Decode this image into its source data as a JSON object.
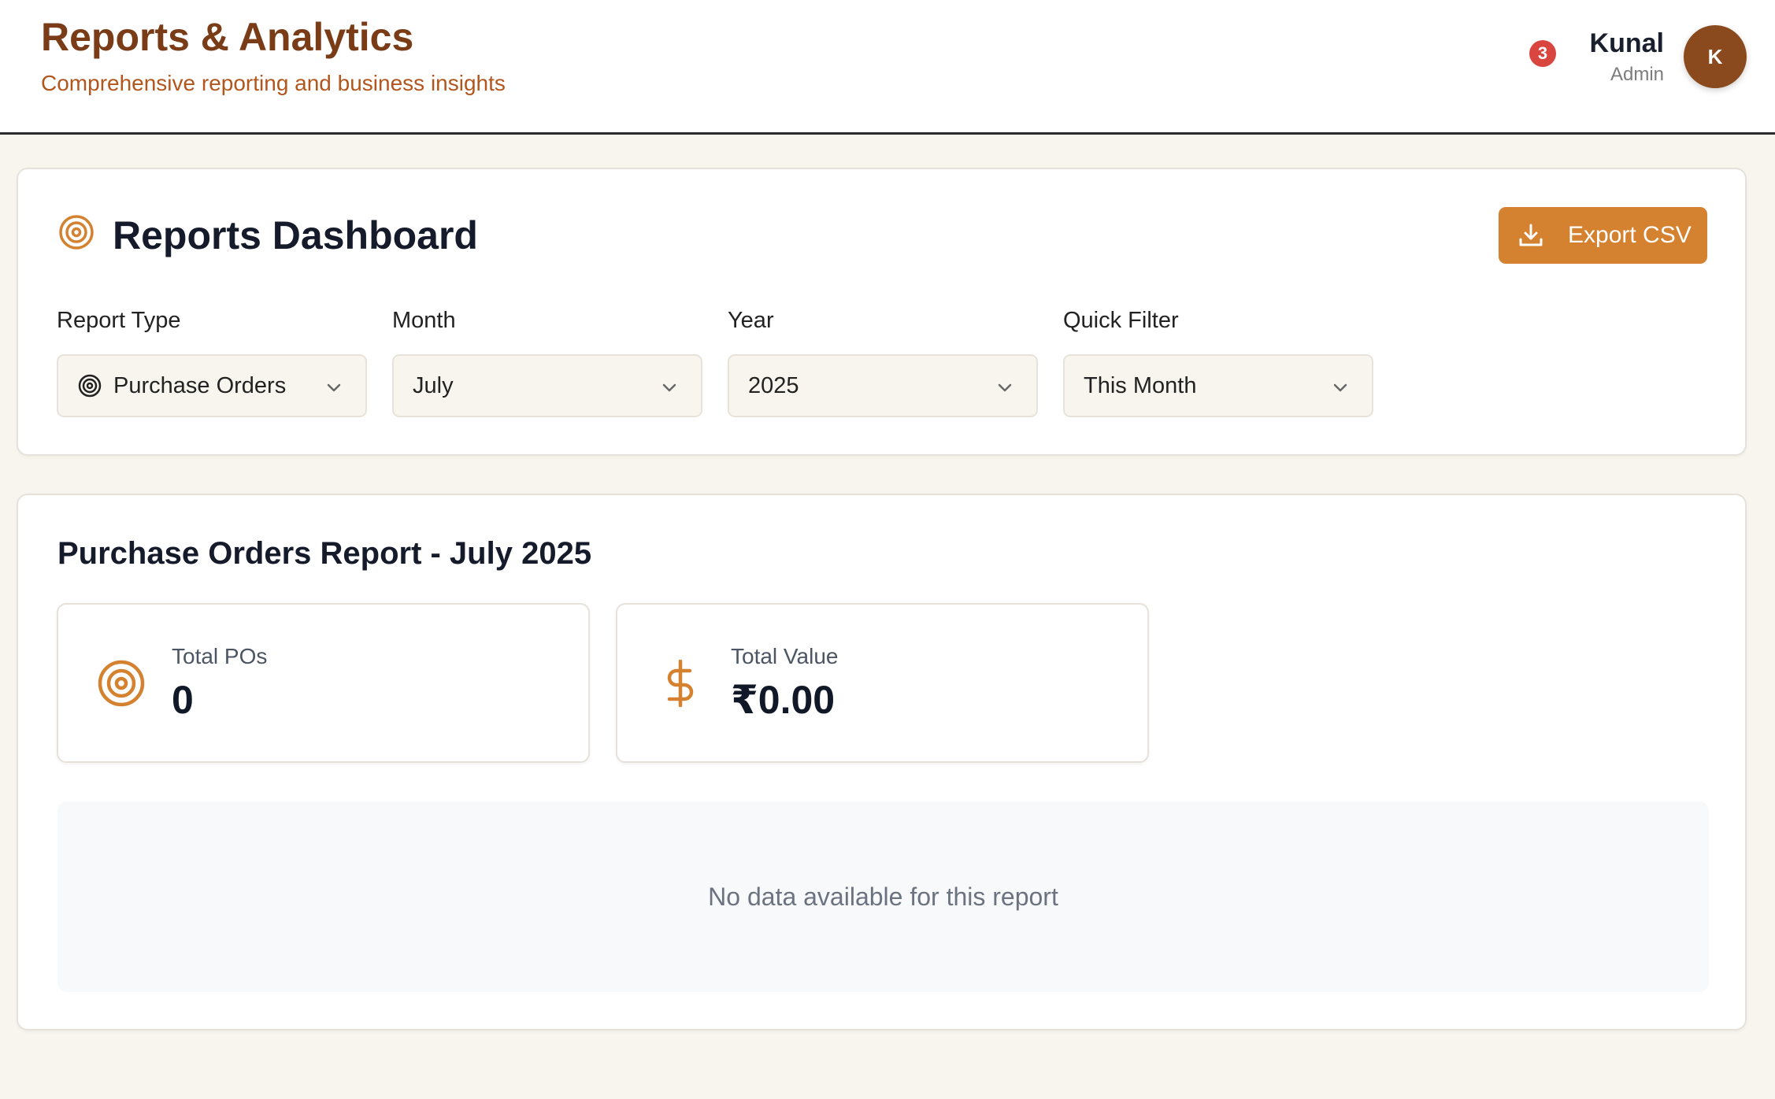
{
  "header": {
    "title": "Reports & Analytics",
    "subtitle": "Comprehensive reporting and business insights",
    "notification_count": "3",
    "user_name": "Kunal",
    "user_role": "Admin",
    "avatar_initial": "K"
  },
  "dashboard": {
    "icon": "target-icon",
    "title": "Reports Dashboard",
    "export_label": "Export CSV",
    "export_icon": "download-icon"
  },
  "filters": {
    "report_type": {
      "label": "Report Type",
      "value": "Purchase Orders",
      "icon": "target-icon"
    },
    "month": {
      "label": "Month",
      "value": "July"
    },
    "year": {
      "label": "Year",
      "value": "2025"
    },
    "quick_filter": {
      "label": "Quick Filter",
      "value": "This Month"
    }
  },
  "report": {
    "title": "Purchase Orders Report - July 2025",
    "stats": [
      {
        "label": "Total POs",
        "value": "0",
        "icon": "target-icon"
      },
      {
        "label": "Total Value",
        "value": "₹0.00",
        "icon": "dollar-icon"
      }
    ],
    "empty_message": "No data available for this report"
  },
  "colors": {
    "accent": "#d4822f",
    "brand_dark": "#7a3c16",
    "subtitle": "#b2561d",
    "badge": "#d9453f",
    "avatar": "#8b4a1e",
    "background": "#f8f5ee"
  }
}
